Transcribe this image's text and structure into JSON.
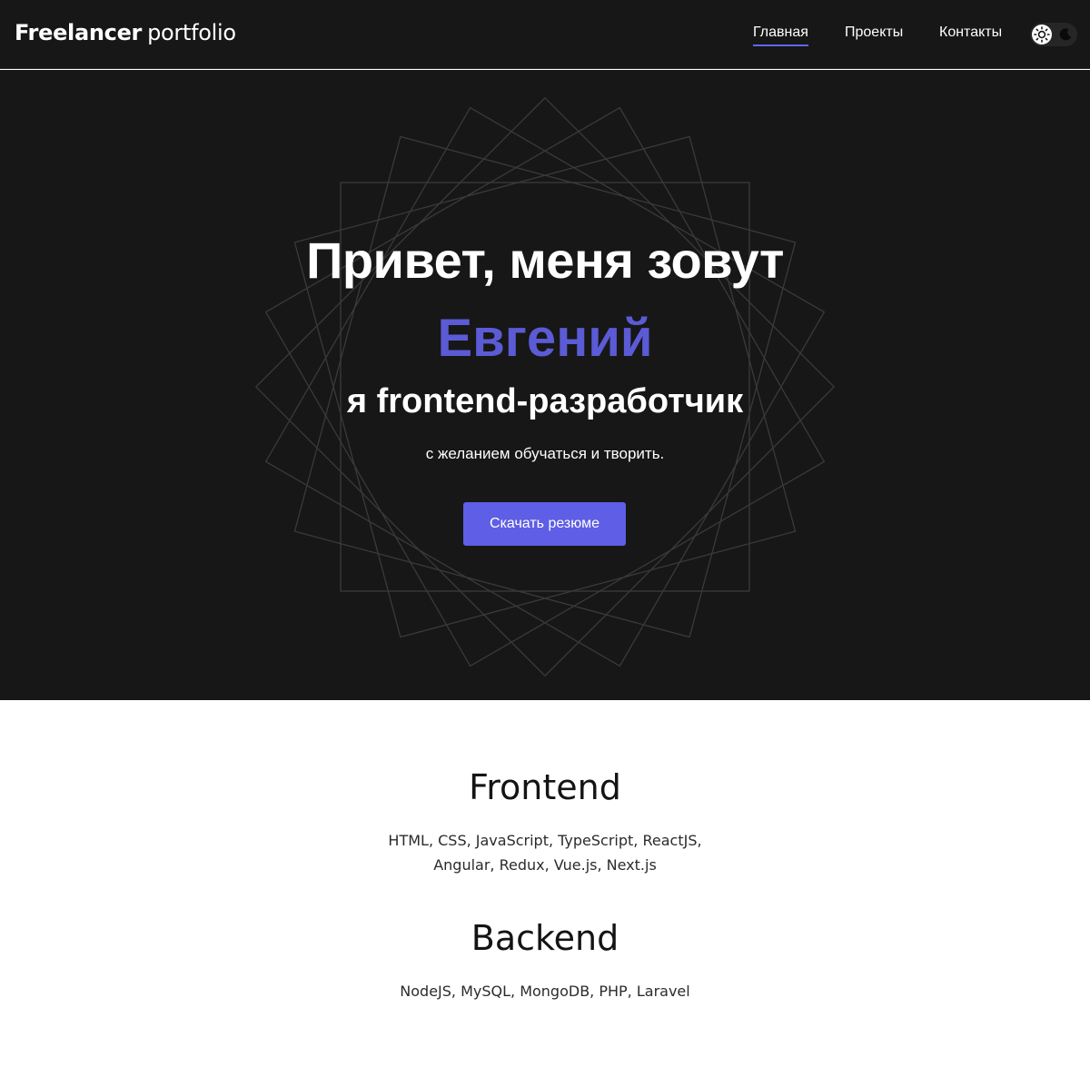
{
  "header": {
    "logo_strong": "Freelancer",
    "logo_light": "portfolio",
    "nav": [
      {
        "label": "Главная",
        "active": true
      },
      {
        "label": "Проекты",
        "active": false
      },
      {
        "label": "Контакты",
        "active": false
      }
    ],
    "theme_toggle": {
      "light_icon": "sun-icon",
      "dark_icon": "moon-icon"
    }
  },
  "hero": {
    "greeting": "Привет, меня зовут",
    "name": "Евгений",
    "role": "я frontend-разработчик",
    "tagline": "с желанием обучаться и творить.",
    "cta_label": "Скачать резюме"
  },
  "skills": {
    "frontend": {
      "title": "Frontend",
      "lines": [
        "HTML, CSS, JavaScript, TypeScript, ReactJS,",
        "Angular, Redux, Vue.js, Next.js"
      ]
    },
    "backend": {
      "title": "Backend",
      "lines": [
        "NodeJS, MySQL, MongoDB, PHP, Laravel"
      ]
    }
  },
  "colors": {
    "dark_bg": "#171717",
    "accent": "#5b5bd6",
    "button": "#5e5ee6",
    "light_bg": "#ffffff"
  }
}
